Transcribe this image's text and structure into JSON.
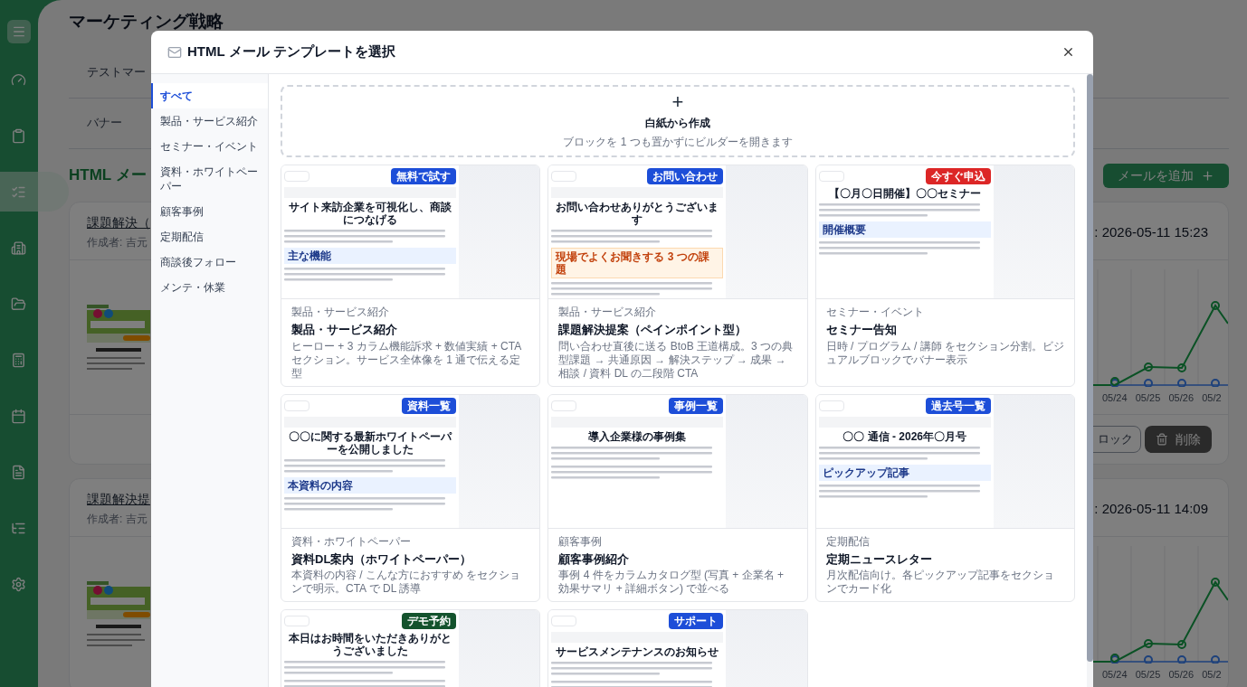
{
  "app_sidebar": {
    "items": [
      {
        "kind": "dashboard",
        "selected": false
      },
      {
        "kind": "clipboard",
        "selected": false
      },
      {
        "kind": "checklist",
        "selected": true
      },
      {
        "kind": "building",
        "selected": false
      },
      {
        "kind": "folder",
        "selected": false
      },
      {
        "kind": "calculator",
        "selected": false
      },
      {
        "kind": "calendar",
        "selected": false
      },
      {
        "kind": "document",
        "selected": false
      },
      {
        "kind": "tree",
        "selected": false
      },
      {
        "kind": "settings",
        "selected": false
      }
    ]
  },
  "page": {
    "title": "マーケティング戦略",
    "rows": [
      "テストマー",
      "バナー"
    ],
    "section_title": "HTML メー",
    "add_button": "メールを追加",
    "emails": [
      {
        "title": "課題解決（",
        "author": "作成者: 吉元",
        "updated": ": 2026-05-11 15:23",
        "chart_labels": [
          "05/24",
          "05/25",
          "05/26",
          "05/2"
        ],
        "actions": [
          {
            "kind": "lock",
            "label": "ロック"
          },
          {
            "kind": "delete",
            "label": "削除"
          }
        ]
      },
      {
        "title": "課題解決提",
        "author": "作成者: 吉元",
        "updated": ": 2026-05-11 14:09",
        "chart_labels": [
          "05/24",
          "05/25",
          "05/26",
          "05/2"
        ]
      }
    ]
  },
  "modal": {
    "title": "HTML メール テンプレートを選択",
    "categories": [
      {
        "label": "すべて",
        "selected": true
      },
      {
        "label": "製品・サービス紹介",
        "selected": false
      },
      {
        "label": "セミナー・イベント",
        "selected": false
      },
      {
        "label": "資料・ホワイトペーパー",
        "selected": false
      },
      {
        "label": "顧客事例",
        "selected": false
      },
      {
        "label": "定期配信",
        "selected": false
      },
      {
        "label": "商談後フォロー",
        "selected": false
      },
      {
        "label": "メンテ・休業",
        "selected": false
      }
    ],
    "blank": {
      "icon": "+",
      "title": "白紙から作成",
      "subtitle": "ブロックを 1 つも置かずにビルダーを開きます"
    },
    "templates": [
      {
        "category": "製品・サービス紹介",
        "title": "製品・サービス紹介",
        "description": "ヒーロー + 3 カラム機能訴求 + 数値実績 + CTA セクション。サービス全体像を 1 通で伝える定型",
        "preview": {
          "cta": "無料で試す",
          "color": "#1d4ed8",
          "has_visual": true,
          "headline": "サイト来訪企業を可視化し、商談につなげる",
          "section": {
            "kind": "info",
            "text": "主な機能"
          }
        }
      },
      {
        "category": "製品・サービス紹介",
        "title": "課題解決提案（ペインポイント型）",
        "description": "問い合わせ直後に送る BtoB 王道構成。3 つの典型課題 → 共通原因 → 解決ステップ → 成果 → 相談 / 資料 DL の二段階 CTA",
        "preview": {
          "cta": "お問い合わせ",
          "color": "#1d4ed8",
          "has_visual": true,
          "headline": "お問い合わせありがとうございます",
          "section": {
            "kind": "warning",
            "text": "現場でよくお聞きする 3 つの課題"
          }
        }
      },
      {
        "category": "セミナー・イベント",
        "title": "セミナー告知",
        "description": "日時 / プログラム / 講師 をセクション分割。ビジュアルブロックでバナー表示",
        "preview": {
          "cta": "今すぐ申込",
          "color": "#dc2626",
          "has_visual": false,
          "headline": "【〇月〇日開催】〇〇セミナー",
          "section": {
            "kind": "info",
            "text": "開催概要"
          }
        }
      },
      {
        "category": "資料・ホワイトペーパー",
        "title": "資料DL案内（ホワイトペーパー）",
        "description": "本資料の内容 / こんな方におすすめ をセクションで明示。CTA で DL 誘導",
        "preview": {
          "cta": "資料一覧",
          "color": "#1d4ed8",
          "has_visual": true,
          "headline": "〇〇に関する最新ホワイトペーパーを公開しました",
          "section": {
            "kind": "info",
            "text": "本資料の内容"
          }
        }
      },
      {
        "category": "顧客事例",
        "title": "顧客事例紹介",
        "description": "事例 4 件をカラムカタログ型 (写真 + 企業名 + 効果サマリ + 詳細ボタン) で並べる",
        "preview": {
          "cta": "事例一覧",
          "color": "#1d4ed8",
          "has_visual": true,
          "headline": "導入企業様の事例集"
        }
      },
      {
        "category": "定期配信",
        "title": "定期ニュースレター",
        "description": "月次配信向け。各ピックアップ記事をセクションでカード化",
        "preview": {
          "cta": "過去号一覧",
          "color": "#1d4ed8",
          "has_visual": true,
          "headline": "〇〇 通信 - 2026年〇月号",
          "section": {
            "kind": "info",
            "text": "ピックアップ記事"
          }
        }
      },
      {
        "preview": {
          "cta": "デモ予約",
          "color": "#14532d",
          "has_visual": false,
          "headline": "本日はお時間をいただきありがとうございました"
        }
      },
      {
        "preview": {
          "cta": "サポート",
          "color": "#1d4ed8",
          "has_visual": true,
          "headline": "サービスメンテナンスのお知らせ"
        }
      }
    ]
  }
}
